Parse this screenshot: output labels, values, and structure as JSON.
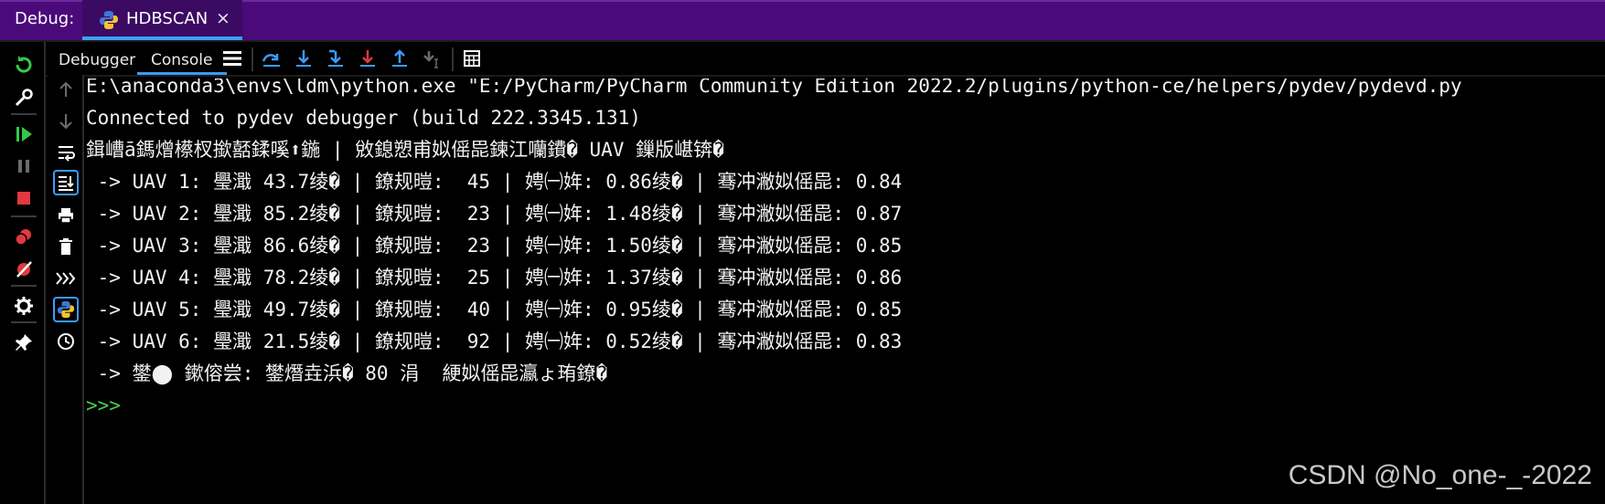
{
  "titlebar": {
    "debug_label": "Debug:",
    "run_tab_name": "HDBSCAN",
    "close_glyph": "×"
  },
  "tabs": {
    "debugger": "Debugger",
    "console": "Console"
  },
  "console": {
    "lines": [
      "E:\\anaconda3\\envs\\ldm\\python.exe \"E:/PyCharm/PyCharm Community Edition 2022.2/plugins/python-ce/helpers/pydev/pydevd.py",
      "Connected to pydev debugger (build 222.3345.131)",
      "鍓嶆ā鎷熷櫒杈撳嚭鍒嗘⬆鍦 | 敓鎴愬甫姒傜巼鍊江囒鐨� UAV 鏁版嵁锛�",
      " -> UAV 1: 璺濈 43.7绫� | 鐐规暟:  45 | 娉㈠姩: 0.86绫� | 骞冲潎姒傜巼: 0.84",
      " -> UAV 2: 璺濈 85.2绫� | 鐐规暟:  23 | 娉㈠姩: 1.48绫� | 骞冲潎姒傜巼: 0.87",
      " -> UAV 3: 璺濈 86.6绫� | 鐐规暟:  23 | 娉㈠姩: 1.50绫� | 骞冲潎姒傜巼: 0.85",
      " -> UAV 4: 璺濈 78.2绫� | 鐐规暟:  25 | 娉㈠姩: 1.37绫� | 骞冲潎姒傜巼: 0.86",
      " -> UAV 5: 璺濈 49.7绫� | 鐐规暟:  40 | 娉㈠姩: 0.95绫� | 骞冲潎姒傜巼: 0.85",
      " -> UAV 6: 璺濈 21.5绫� | 鐐规暟:  92 | 娉㈠姩: 0.52绫� | 骞冲潎姒傜巼: 0.83",
      " -> 鐢⬤ 鏉傛尝: 鐢熸垚浜� 80 涓  綆姒傜巼瀛ょ珛鐐�"
    ],
    "prompt": ">>>"
  },
  "watermark": "CSDN @No_one-_-2022",
  "colors": {
    "titlebar_bg": "#4a0a7a",
    "accent_blue": "#3a9bff",
    "prompt_green": "#47d04a",
    "icon_green": "#35c947",
    "icon_red": "#e0393e"
  }
}
